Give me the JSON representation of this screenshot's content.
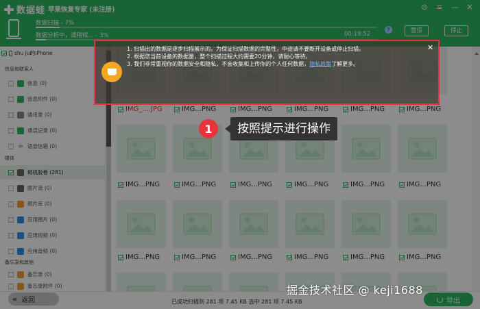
{
  "app": {
    "logo_text": "数据蛙",
    "title": "苹果恢复专家 (未注册)",
    "window_controls": [
      "⊙",
      "≡",
      "—",
      "✕"
    ]
  },
  "scan": {
    "label": "数据扫描 - 7%",
    "progress": 0.07,
    "analyze_label": "数据分析中，请稍候... - 3%",
    "analyze_progress": 0.03,
    "time": "00:19:52",
    "help": "?",
    "pause_label": "暂停",
    "stop_label": "停止"
  },
  "sidebar": {
    "device": "shu ju的iPhone",
    "section1": "信息和联系人",
    "items1": [
      {
        "label": "信息 (0)"
      },
      {
        "label": "信息附件 (0)"
      },
      {
        "label": "通讯录 (0)"
      },
      {
        "label": "通话记录 (0)"
      },
      {
        "label": "语音信箱 (0)"
      }
    ],
    "section2": "媒体",
    "items2": [
      {
        "label": "相机胶卷 (281)"
      },
      {
        "label": "图片流 (0)"
      },
      {
        "label": "照片库 (0)"
      },
      {
        "label": "应用图片 (0)"
      },
      {
        "label": "应用视频 (0)"
      },
      {
        "label": "应用音频 (0)"
      }
    ],
    "section3": "备忘录和其他",
    "items3": [
      {
        "label": "备忘录 (0)"
      },
      {
        "label": "备忘录附件 (0)"
      }
    ]
  },
  "grid": {
    "row1_captions": [
      "IMG_....JPG",
      "IMG...PNG",
      "IMG...PNG",
      "IMG...PNG",
      "IMG...PNG",
      "IMG...PNG"
    ],
    "row2_captions": [
      "IMG...PNG",
      "IMG...PNG",
      "IMG...PNG",
      "IMG...PNG",
      "IMG...PNG",
      "IMG...PNG"
    ],
    "row3_captions": [
      "IMG...PNG",
      "IMG...PNG",
      "IMG...PNG",
      "IMG...PNG",
      "IMG...PNG",
      "IMG...PNG"
    ]
  },
  "notice": {
    "line1": "1. 扫描出的数据是逐步扫描展示的。为保证扫描数据的完整性，中途请不要断开设备或停止扫描。",
    "line2": "2. 根据您当前设备的数据量，整个扫描过程大约需要20分钟，请耐心等待。",
    "line3_prefix": "3. 我们非常重视你的数据安全和隐私，不会收集和上传你的个人任何数据，",
    "line3_link": "隐私政策",
    "line3_suffix": "了解更多。",
    "close": "✕"
  },
  "step": {
    "number": "1",
    "text": "按照提示进行操作"
  },
  "footer": {
    "back_label": "返回",
    "status": "已成功扫描到 281 项 7.45 KB  选中 281 项 7.45 KB",
    "export_label": "导出"
  },
  "watermark": "掘金技术社区 @ keji1688",
  "colors": {
    "brand": "#2db65f",
    "highlight": "#e8333a"
  }
}
